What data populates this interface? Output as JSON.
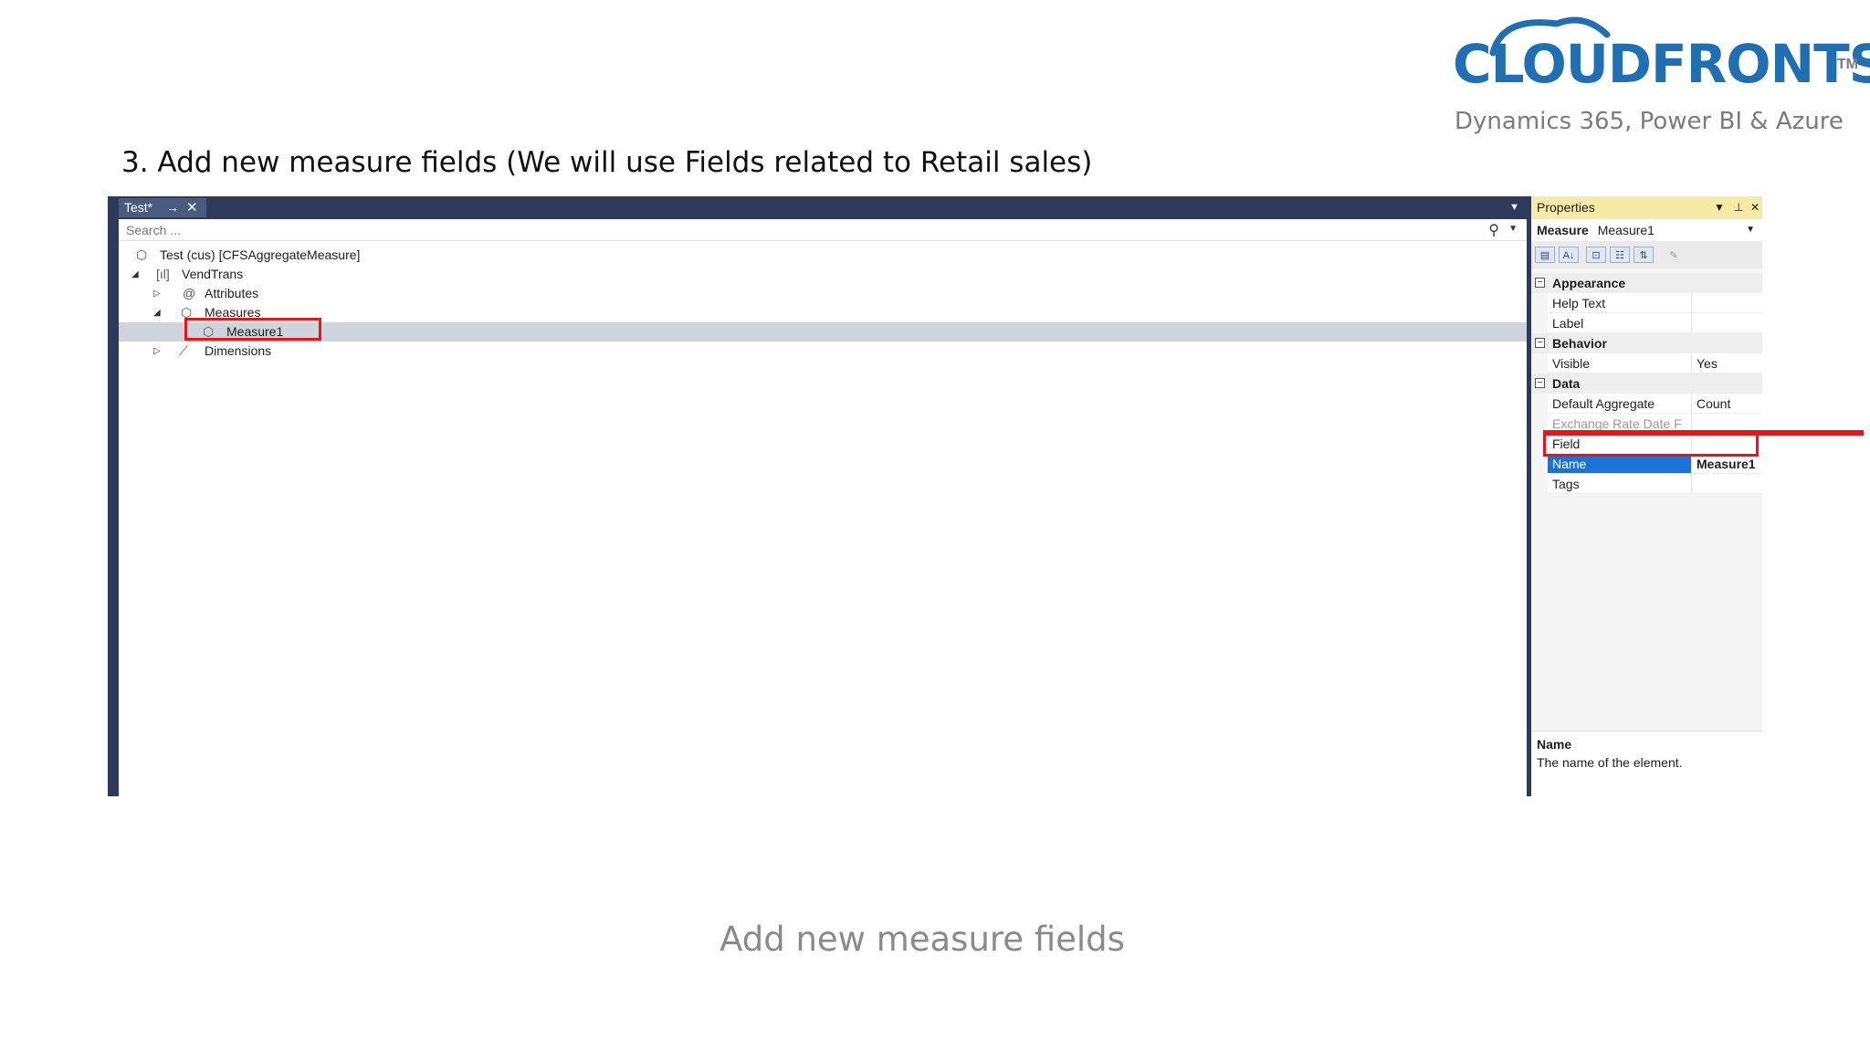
{
  "logo": {
    "brand": "CLOUDFRONTS",
    "trademark": "TM",
    "tagline": "Dynamics 365, Power BI & Azure"
  },
  "slide": {
    "step_title": "3. Add new measure fields (We will use Fields related to Retail sales)",
    "caption": "Add new measure fields"
  },
  "designer": {
    "tab_label": "Test*",
    "tab_pin": "→",
    "tab_close": "✕",
    "search_placeholder": "Search ...",
    "tree": {
      "root": "Test (cus) [CFSAggregateMeasure]",
      "vendtrans": "VendTrans",
      "attributes": "Attributes",
      "measures": "Measures",
      "measure1": "Measure1",
      "dimensions": "Dimensions"
    }
  },
  "properties": {
    "title": "Properties",
    "object_type": "Measure",
    "object_name": "Measure1",
    "categories": {
      "appearance": "Appearance",
      "behavior": "Behavior",
      "data": "Data"
    },
    "rows": {
      "help_text": {
        "name": "Help Text",
        "value": ""
      },
      "label": {
        "name": "Label",
        "value": ""
      },
      "visible": {
        "name": "Visible",
        "value": "Yes"
      },
      "default_aggregate": {
        "name": "Default Aggregate",
        "value": "Count"
      },
      "exchange_rate": {
        "name": "Exchange Rate Date F",
        "value": ""
      },
      "field": {
        "name": "Field",
        "value": ""
      },
      "name": {
        "name": "Name",
        "value": "Measure1"
      },
      "tags": {
        "name": "Tags",
        "value": ""
      }
    },
    "description": {
      "title": "Name",
      "text": "The name of the element."
    }
  },
  "colors": {
    "highlight": "#e8141b",
    "frame": "#2d3a5a",
    "selection": "#1a73d9",
    "properties_header": "#f7eaa6"
  }
}
